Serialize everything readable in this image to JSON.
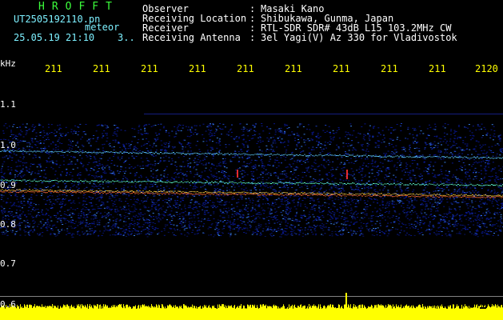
{
  "header": {
    "brand": "HROFFT",
    "file": "UT2505192110.pn",
    "meteor": "meteor",
    "stamp": "25.05.19 21:10    3..",
    "info": [
      {
        "label": "Observer",
        "sep": ":",
        "value": "Masaki Kano"
      },
      {
        "label": "Receiving Location",
        "sep": ":",
        "value": "Shibukawa, Gunma, Japan"
      },
      {
        "label": "Receiver",
        "sep": ":",
        "value": "RTL-SDR SDR# 43dB L15 103.2MHz CW"
      },
      {
        "label": "Receiving Antenna",
        "sep": ":",
        "value": "3el Yagi(V) Az 330 for Vladivostok"
      }
    ]
  },
  "axes": {
    "unit": "kHz",
    "time_ticks": [
      "211",
      "211",
      "211",
      "211",
      "211",
      "211",
      "211",
      "211",
      "211",
      "2120"
    ],
    "freq_ticks": [
      "1.1",
      "1.0",
      "0.9",
      "0.8",
      "0.7",
      "0.6"
    ]
  },
  "colors": {
    "label": "#7df0ff",
    "brand": "#3cff3c",
    "axis": "#ffff00",
    "background": "#000000",
    "noise_floor": "#00108a",
    "signal_high": "#ff3030",
    "power_bar": "#ffff00"
  }
}
